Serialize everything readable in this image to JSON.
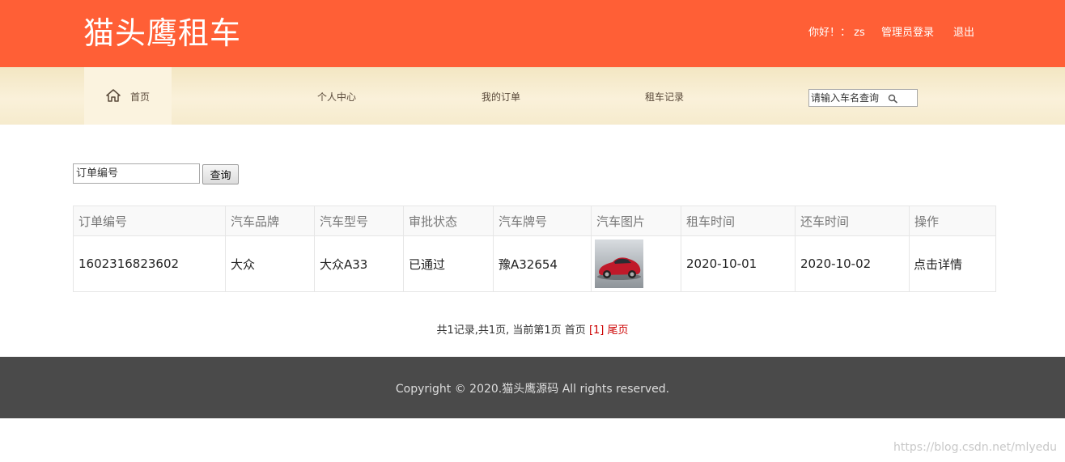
{
  "header": {
    "logo": "猫头鹰租车",
    "greeting": "你好！： zs",
    "admin_login": "管理员登录",
    "logout": "退出",
    "color": "#ff5f36"
  },
  "nav": {
    "home_icon": "home-icon",
    "home": "首页",
    "personal": "个人中心",
    "orders": "我的订单",
    "records": "租车记录",
    "search_placeholder": "请输入车名查询",
    "search_icon": "search-icon"
  },
  "query": {
    "placeholder": "订单编号",
    "button": "查询"
  },
  "table": {
    "headers": [
      "订单编号",
      "汽车品牌",
      "汽车型号",
      "审批状态",
      "汽车牌号",
      "汽车图片",
      "租车时间",
      "还车时间",
      "操作"
    ],
    "rows": [
      {
        "order_no": "1602316823602",
        "brand": "大众",
        "model": "大众A33",
        "status": "已通过",
        "plate": "豫A32654",
        "image": "red-car-thumbnail",
        "rent_date": "2020-10-01",
        "return_date": "2020-10-02",
        "action": "点击详情"
      }
    ]
  },
  "pagination": {
    "summary": "共1记录,共1页, 当前第1页 首页",
    "current": "[1]",
    "last": "尾页"
  },
  "footer": {
    "copyright": "Copyright © 2020.猫头鹰源码 All rights reserved."
  },
  "watermark": "https://blog.csdn.net/mlyedu"
}
